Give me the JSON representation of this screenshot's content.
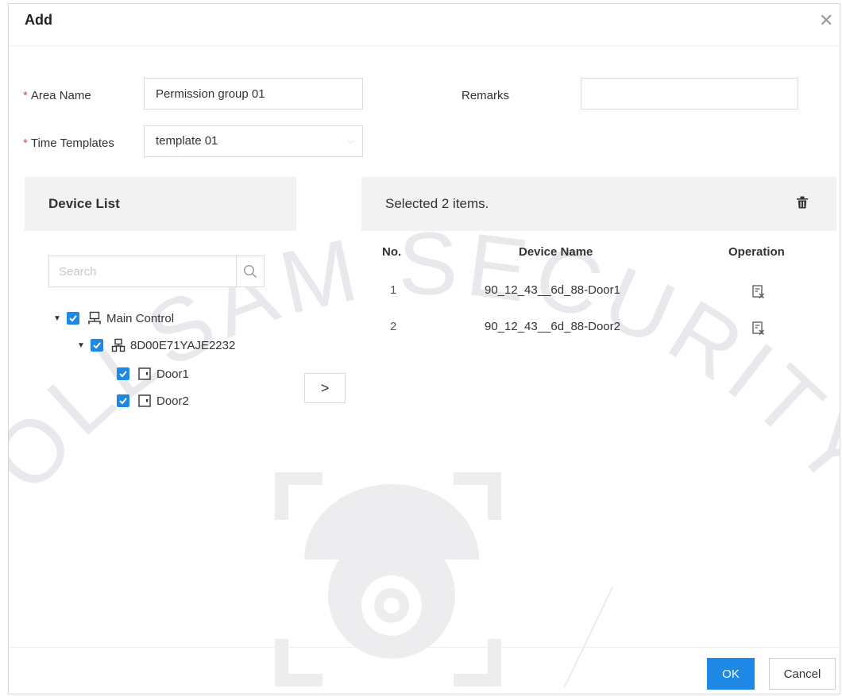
{
  "dialog": {
    "title": "Add"
  },
  "form": {
    "area_name": {
      "label": "Area Name",
      "value": "Permission group 01"
    },
    "remarks": {
      "label": "Remarks",
      "value": ""
    },
    "time_templates": {
      "label": "Time Templates",
      "value": "template 01"
    }
  },
  "device_list": {
    "title": "Device List",
    "search_placeholder": "Search",
    "tree": [
      {
        "label": "Main Control",
        "checked": true,
        "icon": "network-icon"
      },
      {
        "label": "8D00E71YAJE2232",
        "checked": true,
        "icon": "device-icon"
      },
      {
        "label": "Door1",
        "checked": true,
        "icon": "door-icon"
      },
      {
        "label": "Door2",
        "checked": true,
        "icon": "door-icon"
      }
    ]
  },
  "transfer": {
    "label": ">"
  },
  "selected": {
    "title": "Selected 2 items.",
    "columns": {
      "no": "No.",
      "device_name": "Device Name",
      "operation": "Operation"
    },
    "rows": [
      {
        "no": "1",
        "device_name": "90_12_43__6d_88-Door1"
      },
      {
        "no": "2",
        "device_name": "90_12_43__6d_88-Door2"
      }
    ]
  },
  "buttons": {
    "ok": "OK",
    "cancel": "Cancel"
  },
  "watermark": {
    "text": "OLLSAM SECURITY"
  },
  "colors": {
    "primary": "#1e88e5",
    "required": "#e8453c",
    "panel_header": "#f2f2f2"
  }
}
